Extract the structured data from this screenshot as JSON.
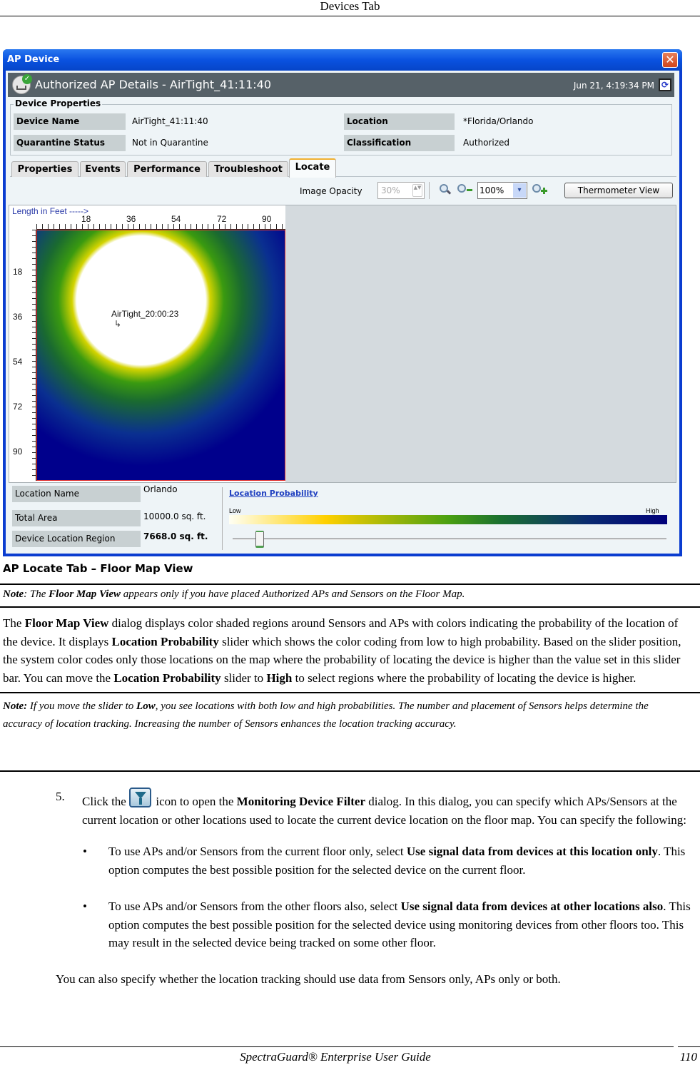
{
  "page_header": "Devices Tab",
  "dialog": {
    "window_title": "AP Device",
    "close_glyph": "✕",
    "header_title": "Authorized AP Details -  AirTight_41:11:40",
    "timestamp": "Jun 21, 4:19:34 PM",
    "refresh_glyph": "⟳",
    "auth_check_glyph": "✓",
    "device_properties": {
      "legend": "Device Properties",
      "rows": [
        {
          "label": "Device Name",
          "value": "AirTight_41:11:40"
        },
        {
          "label": "Quarantine Status",
          "value": "Not in Quarantine"
        },
        {
          "label": "Location",
          "value": "*Florida/Orlando"
        },
        {
          "label": "Classification",
          "value": "Authorized"
        }
      ]
    },
    "tabs": [
      {
        "label": "Properties",
        "active": false
      },
      {
        "label": "Events",
        "active": false
      },
      {
        "label": "Performance",
        "active": false
      },
      {
        "label": "Troubleshoot",
        "active": false
      },
      {
        "label": "Locate",
        "active": true
      }
    ],
    "toolbar": {
      "image_opacity_label": "Image Opacity",
      "image_opacity_value": "30%",
      "spin_glyph": "▲▼",
      "zoom_value": "100%",
      "zoom_arrow_glyph": "▾",
      "thermometer_button": "Thermometer View"
    },
    "map": {
      "length_label": "Length in  Feet ----->",
      "x_ticks": [
        "18",
        "36",
        "54",
        "72",
        "90"
      ],
      "y_ticks": [
        "18",
        "36",
        "54",
        "72",
        "90"
      ],
      "device_label": "AirTight_20:00:23",
      "device_marker_glyph": "↳"
    },
    "location_info": [
      {
        "label": "Location Name",
        "value": "Orlando"
      },
      {
        "label": "Total Area",
        "value": "10000.0 sq. ft."
      },
      {
        "label": "Device Location Region",
        "value": "7668.0 sq.  ft."
      }
    ],
    "probability": {
      "link": "Location Probability",
      "low": "Low",
      "high": "High",
      "slider_value_fraction": 0.04
    }
  },
  "caption": "AP Locate Tab – Floor Map View",
  "note1": {
    "lead": "Note",
    "t1": ": The ",
    "b1": "Floor Map View",
    "t2": " appears only if you have placed Authorized APs and Sensors on the Floor Map."
  },
  "para1": {
    "t1": "The ",
    "b1": "Floor Map View",
    "t2": " dialog displays color shaded regions around Sensors and APs with colors indicating the probability of the location of the device. It displays ",
    "b2": "Location Probability",
    "t3": " slider which shows the color coding from low to high probability. Based on the slider position, the system color codes only those locations on the map where the probability of locating the device is higher than the value set in this slider bar. You can move the ",
    "b3": "Location Probability",
    "t4": " slider to ",
    "b4": "High",
    "t5": " to select regions where the probability of locating the device is higher."
  },
  "note2": {
    "lead": "Note:",
    "t1": " If you move the slider to ",
    "b1": "Low",
    "t2": ", you see locations with both low and high probabilities. The number and placement of Sensors helps determine the accuracy of location tracking. Increasing the number of Sensors enhances the location tracking accuracy."
  },
  "step5": {
    "num": "5.",
    "t1": "Click the ",
    "t2": " icon to open the ",
    "b1": "Monitoring Device Filter",
    "t3": " dialog. In this dialog, you can specify which APs/Sensors at the current location or other locations used to locate the current device location on the floor map. You can specify the following:"
  },
  "bullets": [
    {
      "dot": "•",
      "t1": "To use APs and/or Sensors from the current floor only, select ",
      "b1": "Use signal data from devices at this location only",
      "t2": ". This option computes the best possible position for the selected device on the current floor."
    },
    {
      "dot": "•",
      "t1": "To use APs and/or Sensors from the other floors also, select ",
      "b1": "Use signal data from devices at other locations also",
      "t2": ". This option computes the best possible position for the selected device using monitoring devices from other floors too. This may result in the selected device being tracked on some other floor."
    }
  ],
  "closing": "You can also specify whether the location tracking should use data from Sensors only, APs only or both.",
  "footer": {
    "title": "SpectraGuard® Enterprise User Guide",
    "page": "110"
  }
}
